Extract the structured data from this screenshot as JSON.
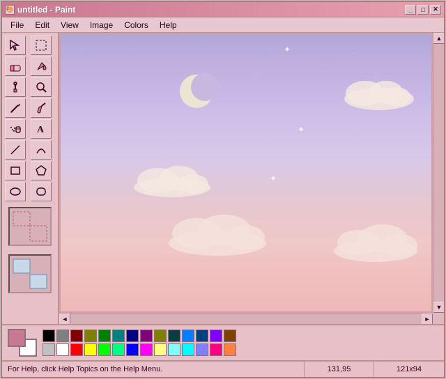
{
  "window": {
    "title": "untitled - Paint",
    "icon": "🖼"
  },
  "title_buttons": {
    "minimize": "_",
    "maximize": "□",
    "close": "✕"
  },
  "menu": {
    "items": [
      "File",
      "Edit",
      "View",
      "Image",
      "Colors",
      "Help"
    ]
  },
  "tools": [
    {
      "icon": "✦",
      "name": "select-free"
    },
    {
      "icon": "⬚",
      "name": "select-rect"
    },
    {
      "icon": "◈",
      "name": "eraser"
    },
    {
      "icon": "⬡",
      "name": "fill"
    },
    {
      "icon": "💧",
      "name": "color-pick"
    },
    {
      "icon": "🔍",
      "name": "zoom"
    },
    {
      "icon": "✏",
      "name": "pencil"
    },
    {
      "icon": "🖌",
      "name": "brush"
    },
    {
      "icon": "✈",
      "name": "airbrush"
    },
    {
      "icon": "A",
      "name": "text"
    },
    {
      "icon": "╱",
      "name": "line"
    },
    {
      "icon": "∿",
      "name": "curve"
    },
    {
      "icon": "□",
      "name": "rectangle"
    },
    {
      "icon": "⬠",
      "name": "polygon"
    },
    {
      "icon": "○",
      "name": "ellipse"
    },
    {
      "icon": "⬭",
      "name": "rounded-rect"
    }
  ],
  "palette": {
    "colors_row1": [
      "#000000",
      "#808080",
      "#800000",
      "#808000",
      "#008000",
      "#008080",
      "#000080",
      "#800080",
      "#808040",
      "#004040",
      "#0080ff",
      "#004080",
      "#8000ff",
      "#804000",
      "#ffffff"
    ],
    "colors_row2": [
      "#c0c0c0",
      "#ffffff",
      "#ff0000",
      "#ffff00",
      "#00ff00",
      "#00ffff",
      "#0000ff",
      "#ff00ff",
      "#ffff80",
      "#00ff80",
      "#80ffff",
      "#8080ff",
      "#ff0080",
      "#ff8040",
      "#ffc0c0"
    ],
    "fg_color": "#c87890",
    "bg_color": "#ffffff"
  },
  "status": {
    "help_text": "For Help, click Help Topics on the Help Menu.",
    "coords": "131,95",
    "size": "121x94"
  },
  "scrollbars": {
    "up": "▲",
    "down": "▼",
    "left": "◄",
    "right": "►"
  }
}
